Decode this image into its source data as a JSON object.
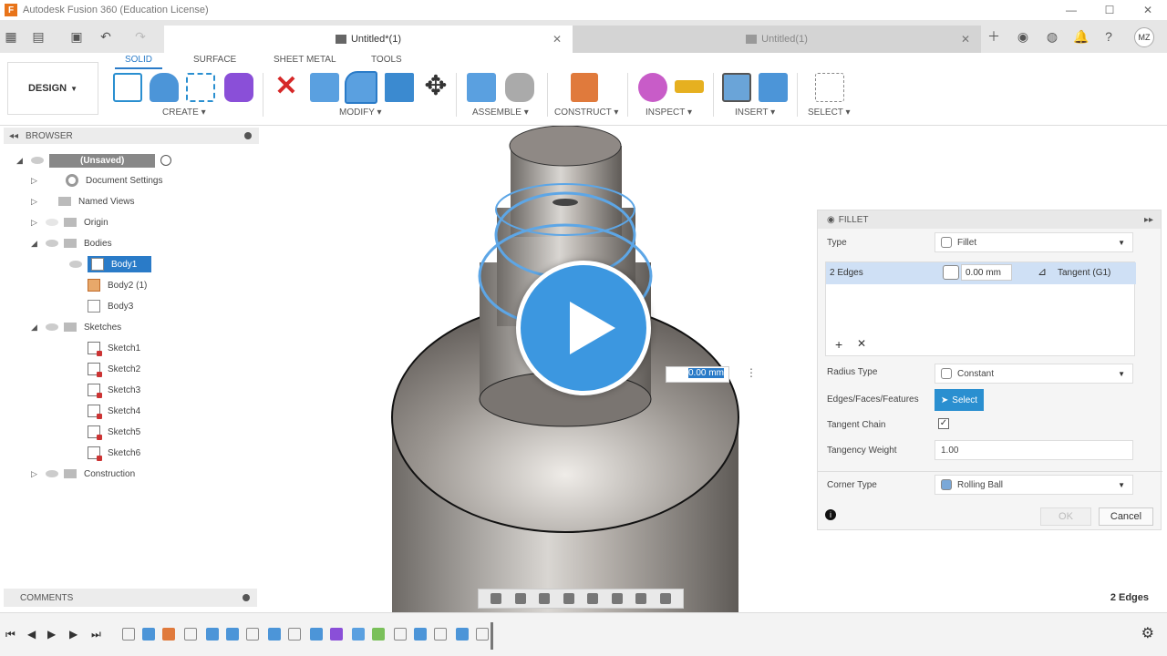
{
  "window": {
    "title": "Autodesk Fusion 360 (Education License)",
    "logo": "F"
  },
  "tabs": {
    "active": "Untitled*(1)",
    "inactive": "Untitled(1)",
    "user_initials": "MZ"
  },
  "toolbar": {
    "workspace": "DESIGN",
    "ribbon_tabs": [
      "SOLID",
      "SURFACE",
      "SHEET METAL",
      "TOOLS"
    ],
    "groups": [
      "CREATE",
      "MODIFY",
      "ASSEMBLE",
      "CONSTRUCT",
      "INSPECT",
      "INSERT",
      "SELECT"
    ]
  },
  "browser": {
    "title": "BROWSER",
    "root": "(Unsaved)",
    "items": {
      "document_settings": "Document Settings",
      "named_views": "Named Views",
      "origin": "Origin",
      "bodies": "Bodies",
      "body1": "Body1",
      "body2": "Body2 (1)",
      "body3": "Body3",
      "sketches": "Sketches",
      "sketch1": "Sketch1",
      "sketch2": "Sketch2",
      "sketch3": "Sketch3",
      "sketch4": "Sketch4",
      "sketch5": "Sketch5",
      "sketch6": "Sketch6",
      "construction": "Construction"
    }
  },
  "fillet": {
    "title": "FILLET",
    "type_label": "Type",
    "type_value": "Fillet",
    "edges_label": "2 Edges",
    "edges_radius": "0.00 mm",
    "edges_continuity": "Tangent (G1)",
    "radius_type_label": "Radius Type",
    "radius_type_value": "Constant",
    "edges_faces_label": "Edges/Faces/Features",
    "select_label": "Select",
    "tangent_chain_label": "Tangent Chain",
    "tangency_weight_label": "Tangency Weight",
    "tangency_weight_value": "1.00",
    "corner_type_label": "Corner Type",
    "corner_type_value": "Rolling Ball",
    "ok_label": "OK",
    "cancel_label": "Cancel"
  },
  "viewport": {
    "radius_input": "0.00 mm"
  },
  "comments_label": "COMMENTS",
  "status": "2 Edges",
  "colors": {
    "accent": "#2a7bc8",
    "select_button": "#2a8fd0",
    "play": "#3c97e0",
    "delete": "#d62828"
  }
}
